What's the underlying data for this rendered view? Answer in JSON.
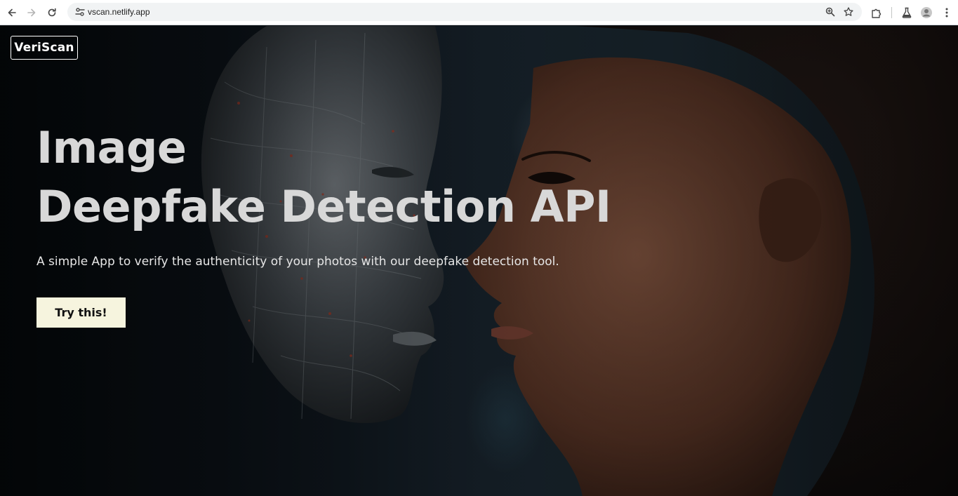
{
  "browser": {
    "url": "vscan.netlify.app",
    "icons": [
      "back-arrow-icon",
      "forward-arrow-icon",
      "reload-icon",
      "site-info-icon",
      "zoom-icon",
      "bookmark-star-icon",
      "extensions-icon",
      "labs-flask-icon",
      "profile-icon",
      "menu-dots-icon"
    ]
  },
  "header": {
    "logo": "VeriScan"
  },
  "hero": {
    "title_line1": "Image",
    "title_line2": "Deepfake Detection API",
    "subtitle": "A simple App to verify the authenticity of your photos with our deepfake detection tool.",
    "cta_label": "Try this!"
  },
  "colors": {
    "title": "#d8d8d8",
    "cta_background": "#f6f4de",
    "cta_text": "#111111",
    "logo": "#ffffff"
  }
}
